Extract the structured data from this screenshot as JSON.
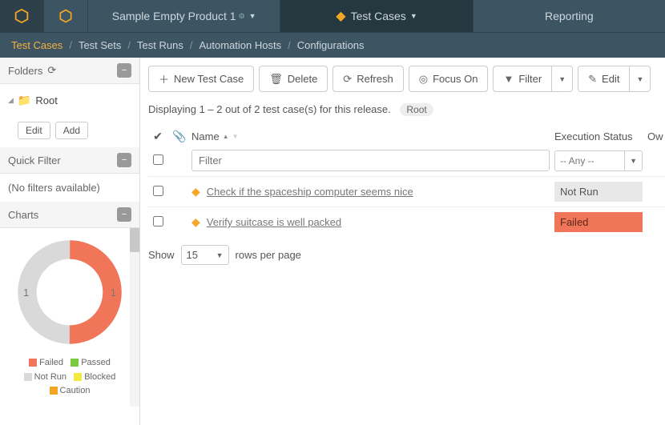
{
  "topbar": {
    "product_name": "Sample Empty Product 1",
    "tc_label": "Test Cases",
    "reporting": "Reporting"
  },
  "subnav": {
    "items": [
      "Test Cases",
      "Test Sets",
      "Test Runs",
      "Automation Hosts",
      "Configurations"
    ],
    "active_index": 0
  },
  "sidebar": {
    "folders_title": "Folders",
    "root_label": "Root",
    "edit_label": "Edit",
    "add_label": "Add",
    "quickfilter_title": "Quick Filter",
    "no_filters_text": "(No filters available)",
    "charts_title": "Charts"
  },
  "toolbar": {
    "new_label": "New Test Case",
    "delete_label": "Delete",
    "refresh_label": "Refresh",
    "focus_label": "Focus On",
    "filter_label": "Filter",
    "edit_label": "Edit"
  },
  "summary": {
    "text": "Displaying 1 – 2 out of 2 test case(s) for this release.",
    "badge": "Root"
  },
  "grid": {
    "columns": {
      "name": "Name",
      "exec": "Execution Status",
      "owner": "Ow"
    },
    "filter_placeholder": "Filter",
    "any_option": "-- Any --",
    "rows": [
      {
        "name": "Check if the spaceship computer seems nice",
        "status": "Not Run",
        "status_class": "stat-notrun"
      },
      {
        "name": "Verify suitcase is well packed",
        "status": "Failed",
        "status_class": "stat-failed"
      }
    ]
  },
  "pager": {
    "show": "Show",
    "value": "15",
    "suffix": "rows per page"
  },
  "chart_data": {
    "type": "pie",
    "title": "",
    "series": [
      {
        "name": "Failed",
        "value": 1,
        "color": "#f17558"
      },
      {
        "name": "Passed",
        "value": 0,
        "color": "#7ac943"
      },
      {
        "name": "Not Run",
        "value": 1,
        "color": "#d9d9d9"
      },
      {
        "name": "Blocked",
        "value": 0,
        "color": "#f4e842"
      },
      {
        "name": "Caution",
        "value": 0,
        "color": "#f5a623"
      }
    ],
    "labels": {
      "left": "1",
      "right": "1"
    }
  }
}
